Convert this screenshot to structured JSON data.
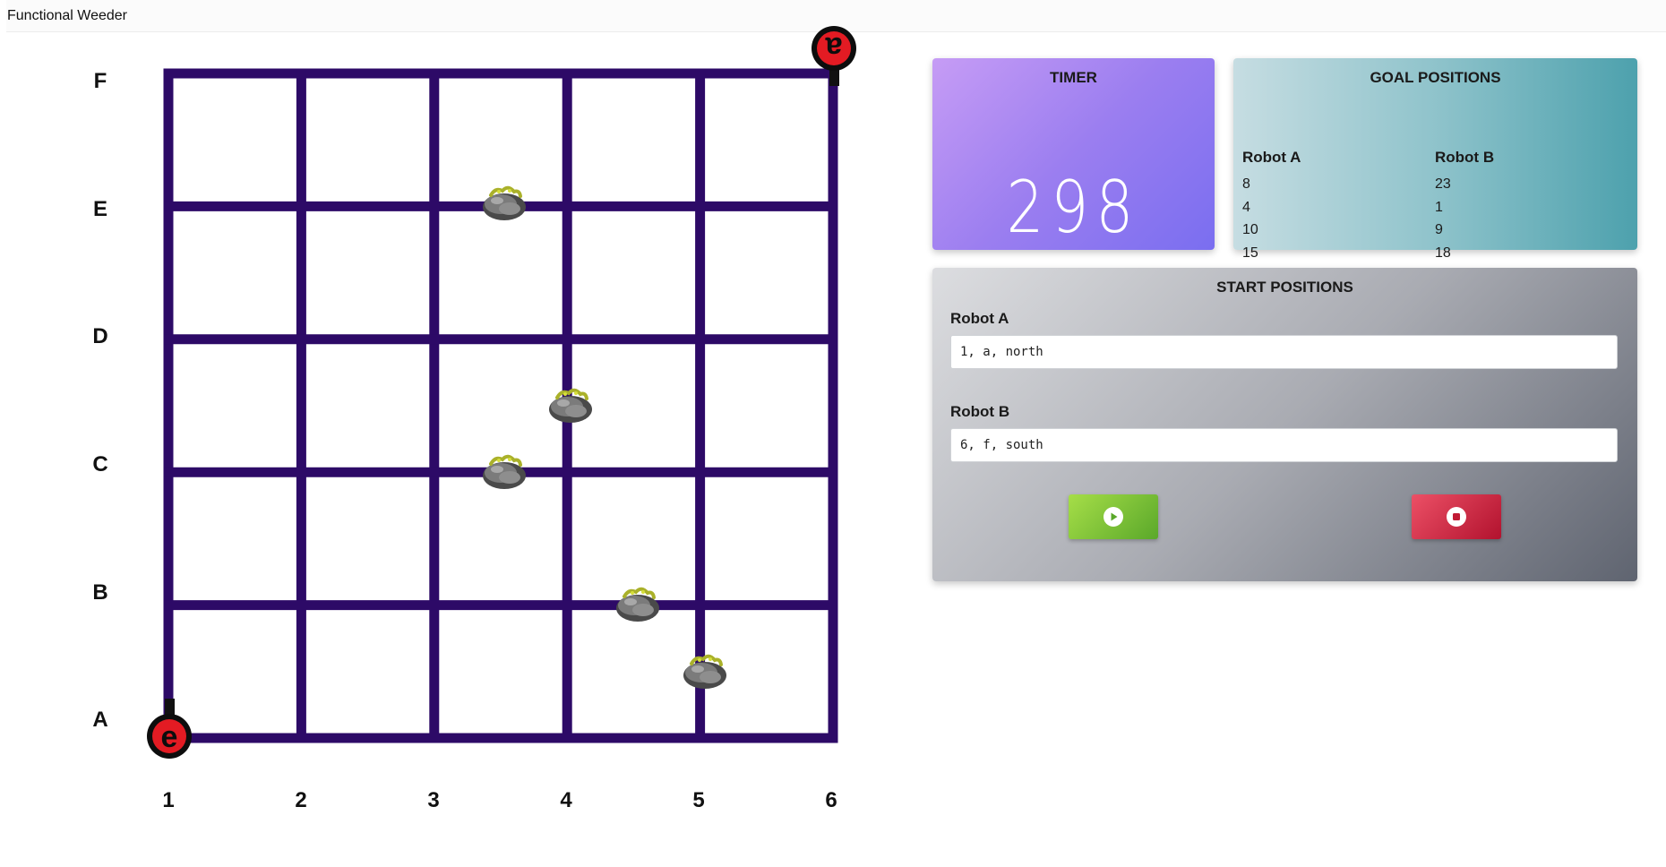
{
  "app": {
    "title": "Functional Weeder"
  },
  "board": {
    "row_labels": [
      "F",
      "E",
      "D",
      "C",
      "B",
      "A"
    ],
    "column_labels": [
      "1",
      "2",
      "3",
      "4",
      "5",
      "6"
    ],
    "robot_a": {
      "icon": "robot-a-icon",
      "letter": "a"
    },
    "robot_b": {
      "icon": "robot-b-icon",
      "letter": "e"
    },
    "weeds_icon": "weed-rock-icon",
    "grid_color": "#2d0a67"
  },
  "timer": {
    "title": "TIMER",
    "value": "298"
  },
  "goals": {
    "title": "GOAL POSITIONS",
    "headers": [
      "Robot A",
      "Robot B"
    ],
    "rows": [
      [
        "8",
        "23"
      ],
      [
        "4",
        "1"
      ],
      [
        "10",
        "9"
      ],
      [
        "15",
        "18"
      ]
    ]
  },
  "start": {
    "title": "START POSITIONS",
    "robot_a_label": "Robot A",
    "robot_a_value": "1, a, north",
    "robot_b_label": "Robot B",
    "robot_b_value": "6, f, south",
    "play_icon": "play-icon",
    "stop_icon": "stop-icon"
  }
}
